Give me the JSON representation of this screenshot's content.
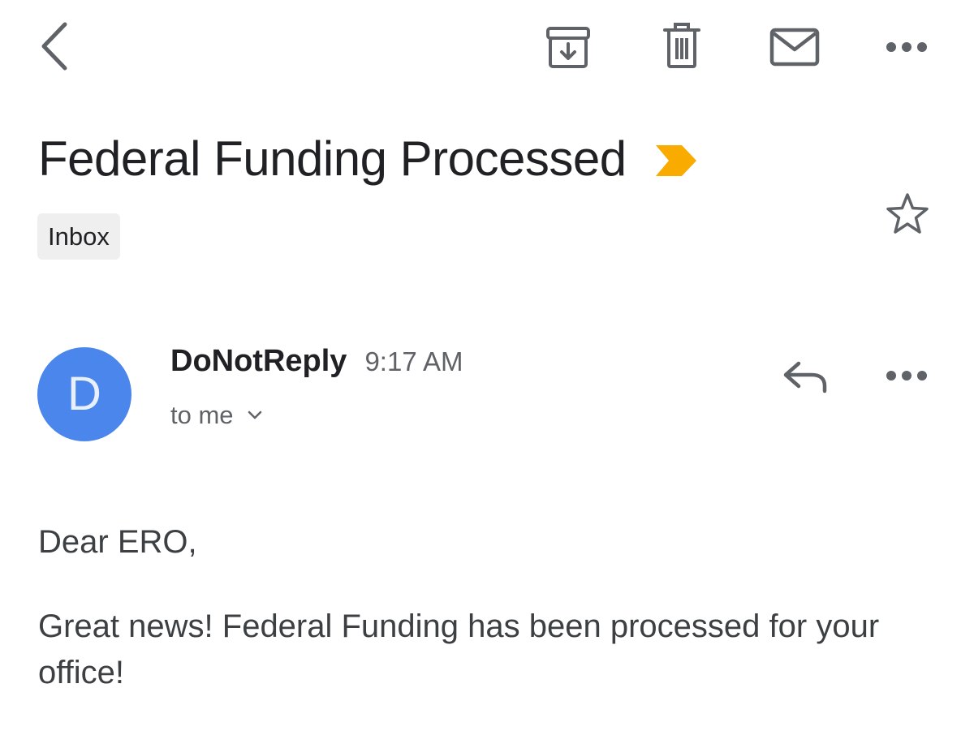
{
  "toolbar": {
    "back_icon": "chevron-left-icon",
    "archive_icon": "archive-icon",
    "delete_icon": "trash-icon",
    "mark_unread_icon": "mail-icon",
    "more_icon": "more-horizontal-icon"
  },
  "message": {
    "subject": "Federal Funding Processed",
    "importance_marker_color": "#f9ab00",
    "label": "Inbox",
    "star_icon": "star-outline-icon"
  },
  "sender": {
    "avatar_letter": "D",
    "avatar_color": "#4a86ec",
    "name": "DoNotReply",
    "time": "9:17 AM",
    "recipient": "to me",
    "reply_icon": "reply-icon",
    "more_icon": "more-horizontal-icon"
  },
  "body": {
    "greeting": "Dear ERO,",
    "text": "Great news! Federal Funding has been processed for your office!"
  }
}
